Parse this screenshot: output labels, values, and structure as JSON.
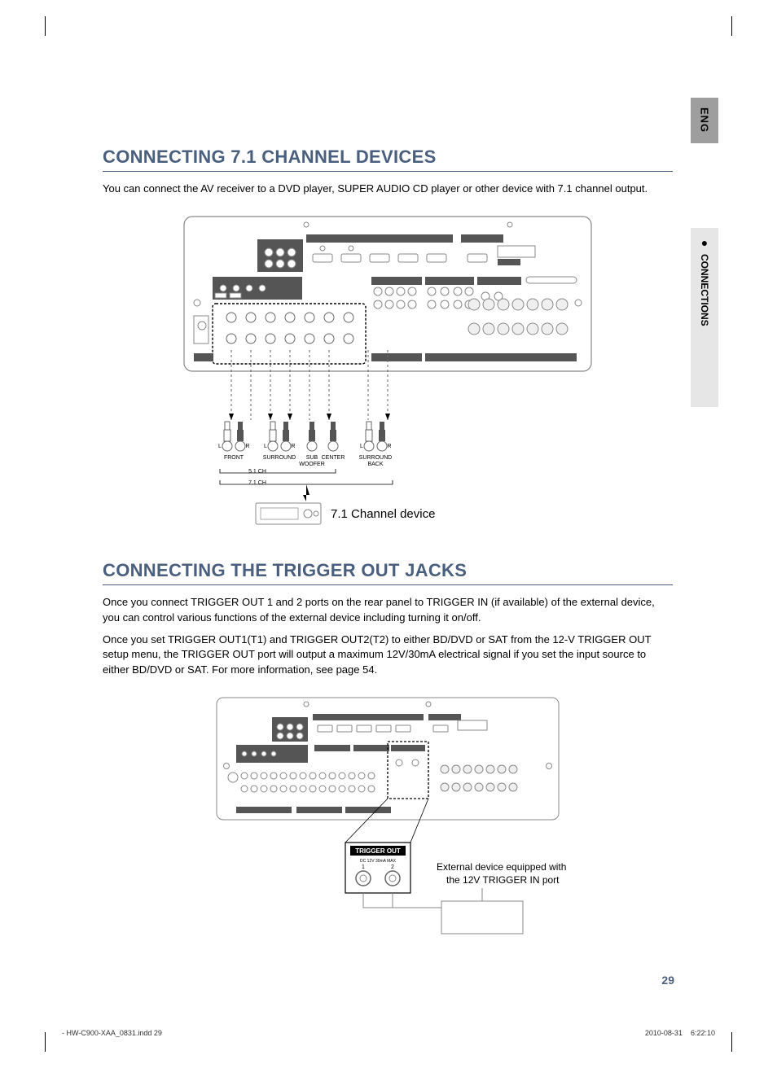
{
  "lang_tab": "ENG",
  "side_tab": "CONNECTIONS",
  "section1": {
    "title": "CONNECTING 7.1 CHANNEL DEVICES",
    "intro": "You can connect the AV receiver to a DVD player, SUPER AUDIO CD player or other device with 7.1 channel output.",
    "diagram": {
      "device_label": "7.1 Channel device",
      "plugs": {
        "front": "FRONT",
        "surround": "SURROUND",
        "subwoofer": "SUB WOOFER",
        "center": "CENTER",
        "surround_back": "SURROUND BACK",
        "left": "L",
        "right": "R"
      },
      "brackets": {
        "ch51": "5.1 CH",
        "ch71": "7.1 CH"
      }
    }
  },
  "section2": {
    "title": "CONNECTING THE TRIGGER OUT JACKS",
    "para1": "Once you connect TRIGGER OUT 1 and 2 ports on the rear panel to TRIGGER IN (if available) of the external device, you can control various functions of the external device including turning it on/off.",
    "para2": "Once you set TRIGGER OUT1(T1) and TRIGGER OUT2(T2) to either BD/DVD or SAT from the 12-V TRIGGER OUT setup menu, the TRIGGER OUT port will output a maximum 12V/30mA electrical signal if you set the input source to either BD/DVD or SAT. For more information, see page 54.",
    "diagram": {
      "trigger_label": "TRIGGER OUT",
      "trigger_sub": "DC 12V 30mA MAX",
      "port1": "1",
      "port2": "2",
      "callout_line1": "External device equipped with",
      "callout_line2": "the 12V TRIGGER IN port"
    }
  },
  "page_number": "29",
  "footer": {
    "left": "- HW-C900-XAA_0831.indd   29",
    "date": "2010-08-31",
    "time": "6:22:10"
  }
}
